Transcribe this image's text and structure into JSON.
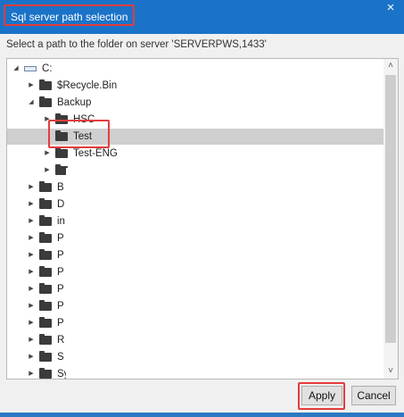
{
  "dialog": {
    "title": "Sql server path selection",
    "close_glyph": "×",
    "instruction": "Select a path to the folder on server 'SERVERPWS,1433'"
  },
  "tree": {
    "drive": {
      "label": "C:",
      "expanded": true,
      "icon": "drive-icon"
    },
    "items": [
      {
        "label": "$Recycle.Bin",
        "level": 1,
        "state": "collapsed"
      },
      {
        "label": "Backup",
        "level": 1,
        "state": "expanded"
      },
      {
        "label": "HSC",
        "level": 2,
        "state": "collapsed"
      },
      {
        "label": "Test",
        "level": 2,
        "state": "leaf",
        "selected": true
      },
      {
        "label": "Test-ENG",
        "level": 2,
        "state": "collapsed"
      },
      {
        "label": "",
        "level": 2,
        "state": "collapsed"
      },
      {
        "label": "B",
        "level": 1,
        "state": "collapsed"
      },
      {
        "label": "D",
        "level": 1,
        "state": "collapsed"
      },
      {
        "label": "in",
        "level": 1,
        "state": "collapsed"
      },
      {
        "label": "P",
        "level": 1,
        "state": "collapsed"
      },
      {
        "label": "P",
        "level": 1,
        "state": "collapsed"
      },
      {
        "label": "P",
        "level": 1,
        "state": "collapsed"
      },
      {
        "label": "P",
        "level": 1,
        "state": "collapsed"
      },
      {
        "label": "P",
        "level": 1,
        "state": "collapsed"
      },
      {
        "label": "P",
        "level": 1,
        "state": "collapsed"
      },
      {
        "label": "R",
        "level": 1,
        "state": "collapsed"
      },
      {
        "label": "S",
        "level": 1,
        "state": "collapsed"
      },
      {
        "label": "Sy",
        "level": 1,
        "state": "collapsed"
      }
    ]
  },
  "glyphs": {
    "collapsed": "▶",
    "expanded": "◢",
    "scroll_up": "˄",
    "scroll_down": "˅"
  },
  "buttons": {
    "apply": "Apply",
    "cancel": "Cancel"
  },
  "colors": {
    "title_bar": "#1a73c8",
    "highlight": "#e33d3d",
    "selection": "#cfcfcf"
  }
}
